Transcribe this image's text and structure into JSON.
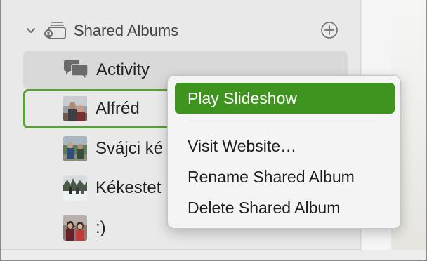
{
  "sidebar": {
    "section": {
      "title": "Shared Albums",
      "expanded_icon": "chevron-down-icon",
      "section_icon": "shared-album-stack-icon",
      "add_icon": "plus-circle-icon"
    },
    "items": [
      {
        "label": "Activity",
        "icon": "speech-bubbles-icon",
        "state": "selected"
      },
      {
        "label": "Alfréd",
        "icon": "album-thumbnail",
        "state": "context-target"
      },
      {
        "label": "Svájci ké",
        "icon": "album-thumbnail",
        "state": "normal"
      },
      {
        "label": "Kékestet",
        "icon": "album-thumbnail",
        "state": "normal"
      },
      {
        "label": ":)",
        "icon": "album-thumbnail",
        "state": "normal"
      }
    ]
  },
  "context_menu": {
    "items": [
      {
        "label": "Play Slideshow",
        "highlighted": true
      },
      {
        "label": "Visit Website…",
        "highlighted": false
      },
      {
        "label": "Rename Shared Album",
        "highlighted": false
      },
      {
        "label": "Delete Shared Album",
        "highlighted": false
      }
    ]
  },
  "colors": {
    "accent": "#3f9420",
    "outline": "#5aa136",
    "selection": "#d9d9da"
  }
}
